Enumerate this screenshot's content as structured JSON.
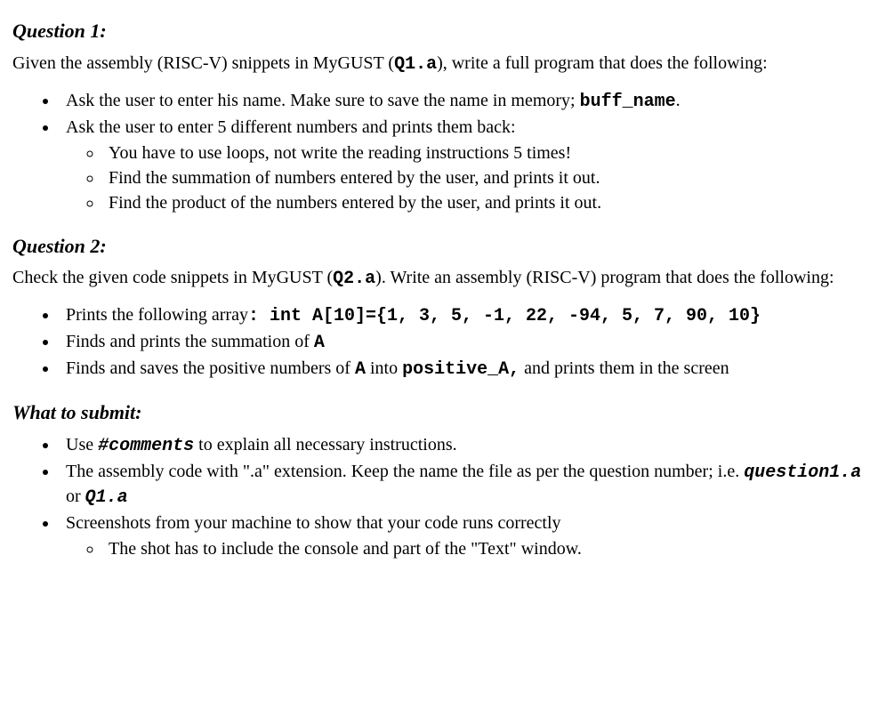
{
  "q1": {
    "heading": "Question 1:",
    "intro_a": "Given the assembly (RISC-V) snippets in MyGUST (",
    "intro_code": "Q1.a",
    "intro_b": "), write a full program that does the following:",
    "b1_a": "Ask the user to enter his name. Make sure to save the name in memory; ",
    "b1_code": "buff_name",
    "b1_b": ".",
    "b2": "Ask the user to enter 5 different numbers and prints them back:",
    "b2_s1": "You have to use loops, not write the reading instructions 5 times!",
    "b2_s2": "Find the summation of numbers entered by the user, and prints it out.",
    "b2_s3": "Find the product of the numbers  entered by the user, and prints it out."
  },
  "q2": {
    "heading": "Question 2:",
    "intro_a": "Check the given code snippets in MyGUST (",
    "intro_code": "Q2.a",
    "intro_b": "). Write an assembly (RISC-V) program that does the following:",
    "b1_a": "Prints the following array",
    "b1_code": ": int A[10]={1, 3, 5, -1, 22, -94, 5, 7, 90, 10}",
    "b2_a": "Finds and prints the summation of ",
    "b2_code": "A",
    "b3_a": "Finds and saves the positive numbers of ",
    "b3_code1": "A",
    "b3_b": " into ",
    "b3_code2": "positive_A,",
    "b3_c": " and prints them in the screen"
  },
  "submit": {
    "heading": "What to submit:",
    "b1_a": "Use ",
    "b1_code": "#comments",
    "b1_b": " to explain all necessary instructions.",
    "b2_a": "The assembly code  with \".a\" extension. Keep the name the file as per the question number; i.e. ",
    "b2_code1": "question1.a",
    "b2_b": " or ",
    "b2_code2": "Q1.a",
    "b3": "Screenshots from your machine to show that your code runs correctly",
    "b3_s1": "The shot has to include the console and part of the \"Text\" window."
  }
}
